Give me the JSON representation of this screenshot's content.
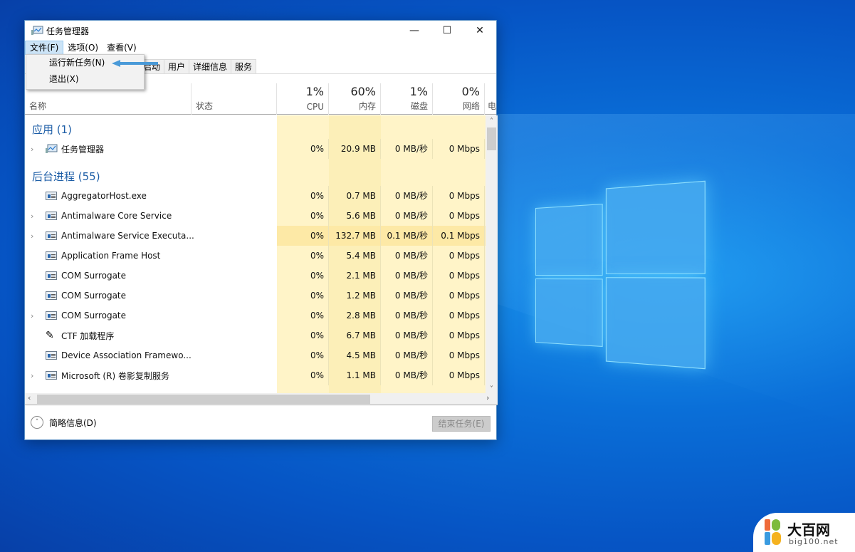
{
  "window": {
    "title": "任务管理器",
    "controls": {
      "minimize": "—",
      "maximize": "☐",
      "close": "✕"
    }
  },
  "menubar": [
    {
      "label": "文件(F)",
      "active": true
    },
    {
      "label": "选项(O)"
    },
    {
      "label": "查看(V)"
    }
  ],
  "file_menu": {
    "items": [
      {
        "label": "运行新任务(N)"
      },
      {
        "label": "退出(X)"
      }
    ]
  },
  "tabs": [
    {
      "label": "启动"
    },
    {
      "label": "用户"
    },
    {
      "label": "详细信息"
    },
    {
      "label": "服务"
    }
  ],
  "columns": {
    "name": "名称",
    "status": "状态",
    "cpu": {
      "pct": "1%",
      "label": "CPU"
    },
    "memory": {
      "pct": "60%",
      "label": "内存"
    },
    "disk": {
      "pct": "1%",
      "label": "磁盘"
    },
    "network": {
      "pct": "0%",
      "label": "网络"
    },
    "power": "电"
  },
  "groups": {
    "apps": "应用 (1)",
    "background": "后台进程 (55)"
  },
  "apps": [
    {
      "name": "任务管理器",
      "expandable": true,
      "cpu": "0%",
      "mem": "20.9 MB",
      "disk": "0 MB/秒",
      "net": "0 Mbps"
    }
  ],
  "processes": [
    {
      "name": "AggregatorHost.exe",
      "expandable": false,
      "cpu": "0%",
      "mem": "0.7 MB",
      "disk": "0 MB/秒",
      "net": "0 Mbps"
    },
    {
      "name": "Antimalware Core Service",
      "expandable": true,
      "cpu": "0%",
      "mem": "5.6 MB",
      "disk": "0 MB/秒",
      "net": "0 Mbps"
    },
    {
      "name": "Antimalware Service Executa...",
      "expandable": true,
      "cpu": "0%",
      "mem": "132.7 MB",
      "disk": "0.1 MB/秒",
      "net": "0.1 Mbps"
    },
    {
      "name": "Application Frame Host",
      "expandable": false,
      "cpu": "0%",
      "mem": "5.4 MB",
      "disk": "0 MB/秒",
      "net": "0 Mbps"
    },
    {
      "name": "COM Surrogate",
      "expandable": false,
      "cpu": "0%",
      "mem": "2.1 MB",
      "disk": "0 MB/秒",
      "net": "0 Mbps"
    },
    {
      "name": "COM Surrogate",
      "expandable": false,
      "cpu": "0%",
      "mem": "1.2 MB",
      "disk": "0 MB/秒",
      "net": "0 Mbps"
    },
    {
      "name": "COM Surrogate",
      "expandable": true,
      "cpu": "0%",
      "mem": "2.8 MB",
      "disk": "0 MB/秒",
      "net": "0 Mbps"
    },
    {
      "name": "CTF 加载程序",
      "expandable": false,
      "icon": "pen-icon",
      "cpu": "0%",
      "mem": "6.7 MB",
      "disk": "0 MB/秒",
      "net": "0 Mbps"
    },
    {
      "name": "Device Association Framewo...",
      "expandable": false,
      "cpu": "0%",
      "mem": "4.5 MB",
      "disk": "0 MB/秒",
      "net": "0 Mbps"
    },
    {
      "name": "Microsoft (R) 卷影复制服务",
      "expandable": true,
      "cpu": "0%",
      "mem": "1.1 MB",
      "disk": "0 MB/秒",
      "net": "0 Mbps"
    }
  ],
  "footer": {
    "fewer_details": "简略信息(D)",
    "end_task": "结束任务(E)"
  },
  "watermark": {
    "name": "大百网",
    "url": "big100.net"
  }
}
